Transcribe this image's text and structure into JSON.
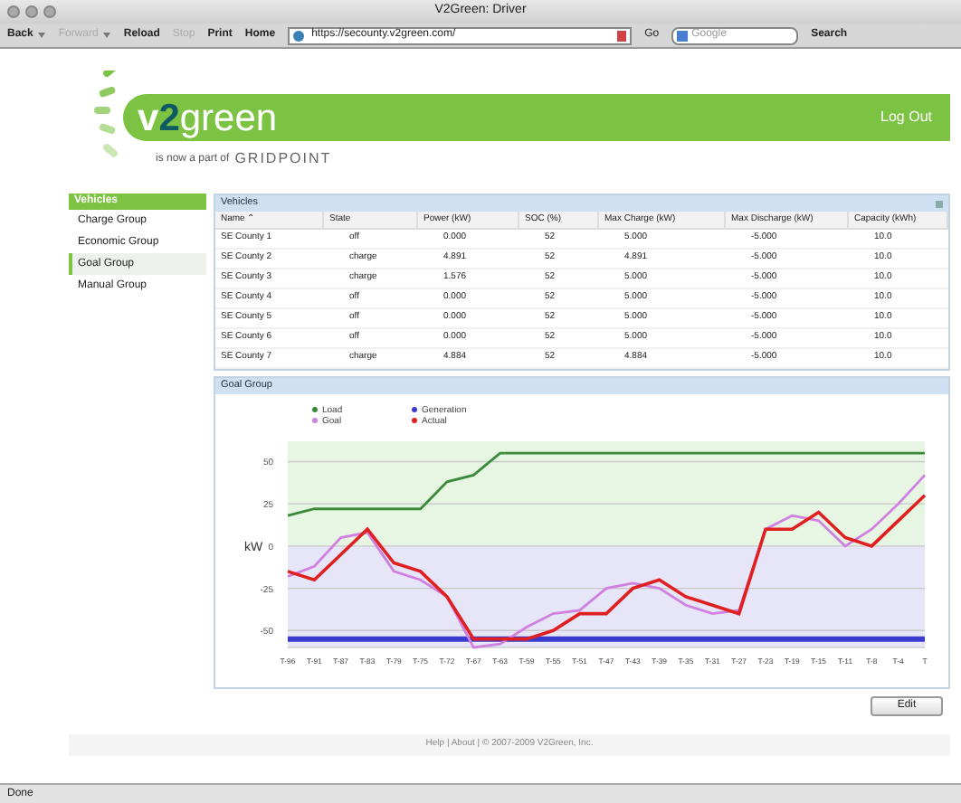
{
  "window": {
    "title": "V2Green: Driver"
  },
  "toolbar": {
    "buttons": [
      {
        "label": "Back",
        "disabled": false,
        "menu": true
      },
      {
        "label": "Forward",
        "disabled": true,
        "menu": true
      },
      {
        "label": "Reload",
        "disabled": false,
        "menu": false
      },
      {
        "label": "Stop",
        "disabled": true,
        "menu": false
      },
      {
        "label": "Print",
        "disabled": false,
        "menu": false
      },
      {
        "label": "Home",
        "disabled": false,
        "menu": false
      }
    ],
    "url": "https://secounty.v2green.com/",
    "go": "Go",
    "search_placeholder": "Google",
    "search": "Search"
  },
  "header": {
    "logo": [
      {
        "text": "v",
        "accent": false
      },
      {
        "text": "2",
        "accent": true
      },
      {
        "text": "green",
        "accent": false
      }
    ],
    "tagline": "is now a part of",
    "partner": "GRIDPOINT",
    "logout": "Log Out"
  },
  "sidebar": {
    "title": "Vehicles",
    "items": [
      {
        "label": "Charge Group",
        "selected": false
      },
      {
        "label": "Economic Group",
        "selected": false
      },
      {
        "label": "Goal Group",
        "selected": true
      },
      {
        "label": "Manual Group",
        "selected": false
      }
    ]
  },
  "vehicles": {
    "title": "Vehicles",
    "columns": [
      "Name ⌃",
      "State",
      "Power (kW)",
      "SOC (%)",
      "Max Charge (kW)",
      "Max Discharge (kW)",
      "Capacity (kWh)"
    ],
    "rows": [
      [
        "SE County 1",
        "off",
        "0.000",
        "52",
        "5.000",
        "-5.000",
        "10.0"
      ],
      [
        "SE County 2",
        "charge",
        "4.891",
        "52",
        "4.891",
        "-5.000",
        "10.0"
      ],
      [
        "SE County 3",
        "charge",
        "1.576",
        "52",
        "5.000",
        "-5.000",
        "10.0"
      ],
      [
        "SE County 4",
        "off",
        "0.000",
        "52",
        "5.000",
        "-5.000",
        "10.0"
      ],
      [
        "SE County 5",
        "off",
        "0.000",
        "52",
        "5.000",
        "-5.000",
        "10.0"
      ],
      [
        "SE County 6",
        "off",
        "0.000",
        "52",
        "5.000",
        "-5.000",
        "10.0"
      ],
      [
        "SE County 7",
        "charge",
        "4.884",
        "52",
        "4.884",
        "-5.000",
        "10.0"
      ]
    ]
  },
  "goal_group": {
    "title": "Goal Group",
    "chart_data": {
      "type": "line",
      "grid": true,
      "legend": true,
      "ylabel": "kW",
      "ylim": [
        -60,
        62
      ],
      "yticks": [
        -50,
        -25,
        0,
        25,
        50
      ],
      "categories": [
        "T-96",
        "T-91",
        "T-87",
        "T-83",
        "T-79",
        "T-75",
        "T-72",
        "T-67",
        "T-63",
        "T-59",
        "T-55",
        "T-51",
        "T-47",
        "T-43",
        "T-39",
        "T-35",
        "T-31",
        "T-27",
        "T-23",
        "T-19",
        "T-15",
        "T-11",
        "T-8",
        "T-4",
        "T"
      ],
      "series": [
        {
          "name": "Load",
          "color": "#3a8a3a",
          "values": [
            18,
            22,
            22,
            22,
            22,
            22,
            38,
            42,
            55,
            55,
            55,
            55,
            55,
            55,
            55,
            55,
            55,
            55,
            55,
            55,
            55,
            55,
            55,
            55,
            55
          ]
        },
        {
          "name": "Generation",
          "color": "#3b3bd0",
          "values": [
            -55,
            -55,
            -55,
            -55,
            -55,
            -55,
            -55,
            -55,
            -55,
            -55,
            -55,
            -55,
            -55,
            -55,
            -55,
            -55,
            -55,
            -55,
            -55,
            -55,
            -55,
            -55,
            -55,
            -55,
            -55
          ]
        },
        {
          "name": "Goal",
          "color": "#d080e0",
          "values": [
            -18,
            -12,
            5,
            8,
            -15,
            -20,
            -30,
            -60,
            -58,
            -48,
            -40,
            -38,
            -25,
            -22,
            -25,
            -35,
            -40,
            -38,
            10,
            18,
            15,
            0,
            10,
            25,
            42
          ]
        },
        {
          "name": "Actual",
          "color": "#e02020",
          "values": [
            -15,
            -20,
            -5,
            10,
            -10,
            -15,
            -30,
            -55,
            -55,
            -55,
            -50,
            -40,
            -40,
            -25,
            -20,
            -30,
            -35,
            -40,
            10,
            10,
            20,
            5,
            0,
            15,
            30
          ]
        }
      ]
    },
    "edit": "Edit"
  },
  "footer": "Help | About | © 2007-2009 V2Green, Inc.",
  "status_bar": "Done"
}
